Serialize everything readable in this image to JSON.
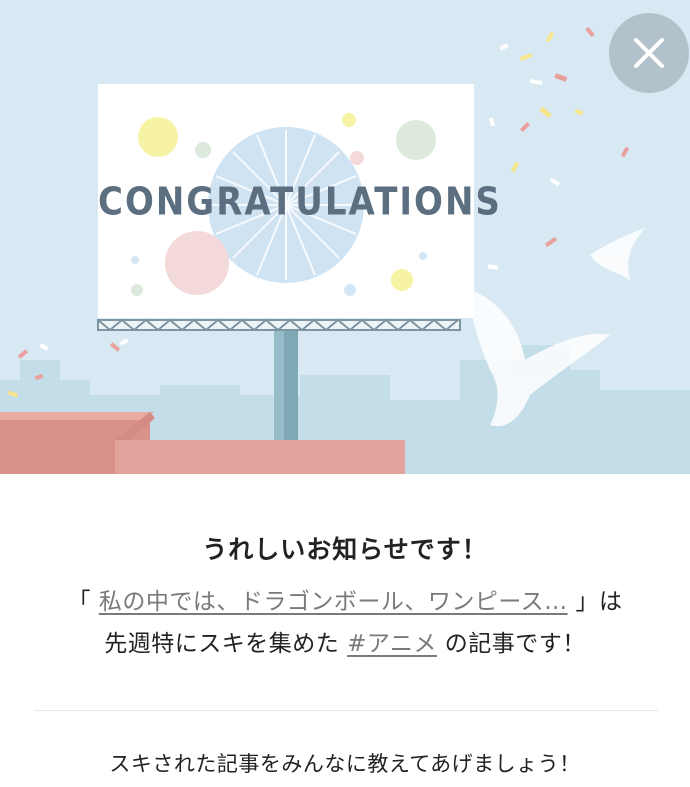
{
  "hero": {
    "billboard_text": "CONGRATULATIONS",
    "colors": {
      "sky": "#d8e9f3",
      "billboard": "#ffffff",
      "roof": "#e2a39c",
      "city": "#c3dde9",
      "text": "#5b6f80"
    }
  },
  "close_button": {
    "icon": "close-icon"
  },
  "message": {
    "heading": "うれしいお知らせです！",
    "quote_open": "「",
    "article_title": "私の中では、ドラゴンボール、ワンピース…",
    "quote_close": "」は",
    "line2_prefix": "先週特にスキを集めた",
    "hashtag": "#アニメ",
    "line2_suffix": "の記事です！"
  },
  "share": {
    "text": "スキされた記事をみんなに教えてあげましょう！"
  }
}
